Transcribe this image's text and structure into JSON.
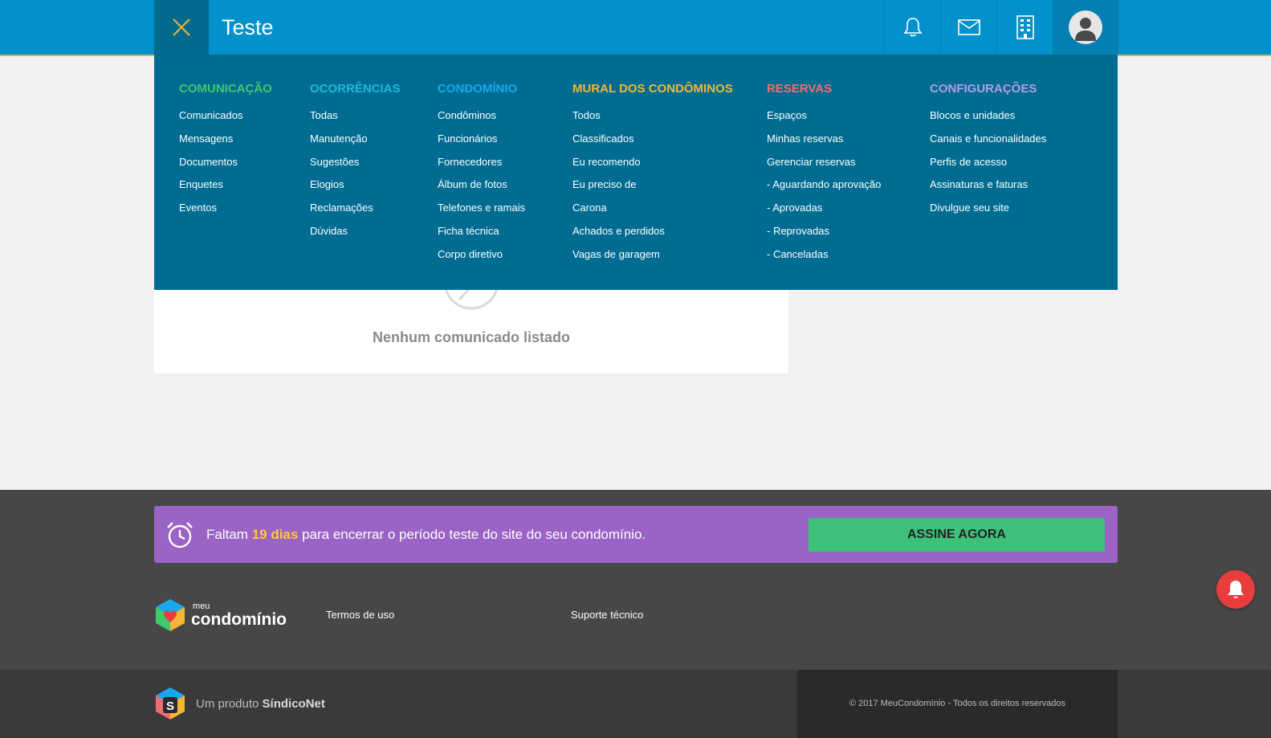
{
  "header": {
    "title": "Teste",
    "icons": [
      "close-icon",
      "bell-icon",
      "mail-icon",
      "building-icon",
      "user-avatar-icon"
    ]
  },
  "menu": {
    "columns": [
      {
        "title": "COMUNICAÇÃO",
        "color": "#3ec96b",
        "items": [
          "Comunicados",
          "Mensagens",
          "Documentos",
          "Enquetes",
          "Eventos"
        ]
      },
      {
        "title": "OCORRÊNCIAS",
        "color": "#22b8d6",
        "items": [
          "Todas",
          "Manutenção",
          "Sugestões",
          "Elogios",
          "Reclamações",
          "Dúvidas"
        ]
      },
      {
        "title": "CONDOMÍNIO",
        "color": "#17a9f0",
        "items": [
          "Condôminos",
          "Funcionários",
          "Fornecedores",
          "Álbum de fotos",
          "Telefones e ramais",
          "Ficha técnica",
          "Corpo diretivo"
        ]
      },
      {
        "title": "MURAL DOS CONDÔMINOS",
        "color": "#f5b731",
        "items": [
          "Todos",
          "Classificados",
          "Eu recomendo",
          "Eu preciso de",
          "Carona",
          "Achados e perdidos",
          "Vagas de garagem"
        ]
      },
      {
        "title": "RESERVAS",
        "color": "#ee6e73",
        "items": [
          "Espaços",
          "Minhas reservas",
          "Gerenciar reservas",
          "- Aguardando aprovação",
          "- Aprovadas",
          "- Reprovadas",
          "- Canceladas"
        ]
      },
      {
        "title": "CONFIGURAÇÕES",
        "color": "#b69ee8",
        "items": [
          "Blocos e unidades",
          "Canais e funcionalidades",
          "Perfis de acesso",
          "Assinaturas e faturas",
          "Divulgue seu site"
        ]
      }
    ]
  },
  "content": {
    "empty_message": "Nenhum comunicado listado"
  },
  "trial": {
    "prefix": "Faltam ",
    "days": "19 dias",
    "suffix": " para encerrar o período teste do site do seu condomínio.",
    "button": "ASSINE AGORA"
  },
  "footer": {
    "logo_small": "meu",
    "logo_main": "condomínio",
    "links": [
      "Termos de uso",
      "Suporte técnico"
    ],
    "product_prefix": "Um produto ",
    "product_name": "SíndicoNet",
    "copyright": "© 2017 MeuCondomínio - Todos os direitos reservados"
  },
  "colors": {
    "topbar": "#0391cb",
    "menu_bg": "#006c91",
    "trial_bg": "#9a63c5",
    "subscribe": "#3dc17a",
    "highlight": "#ffcb2f"
  }
}
